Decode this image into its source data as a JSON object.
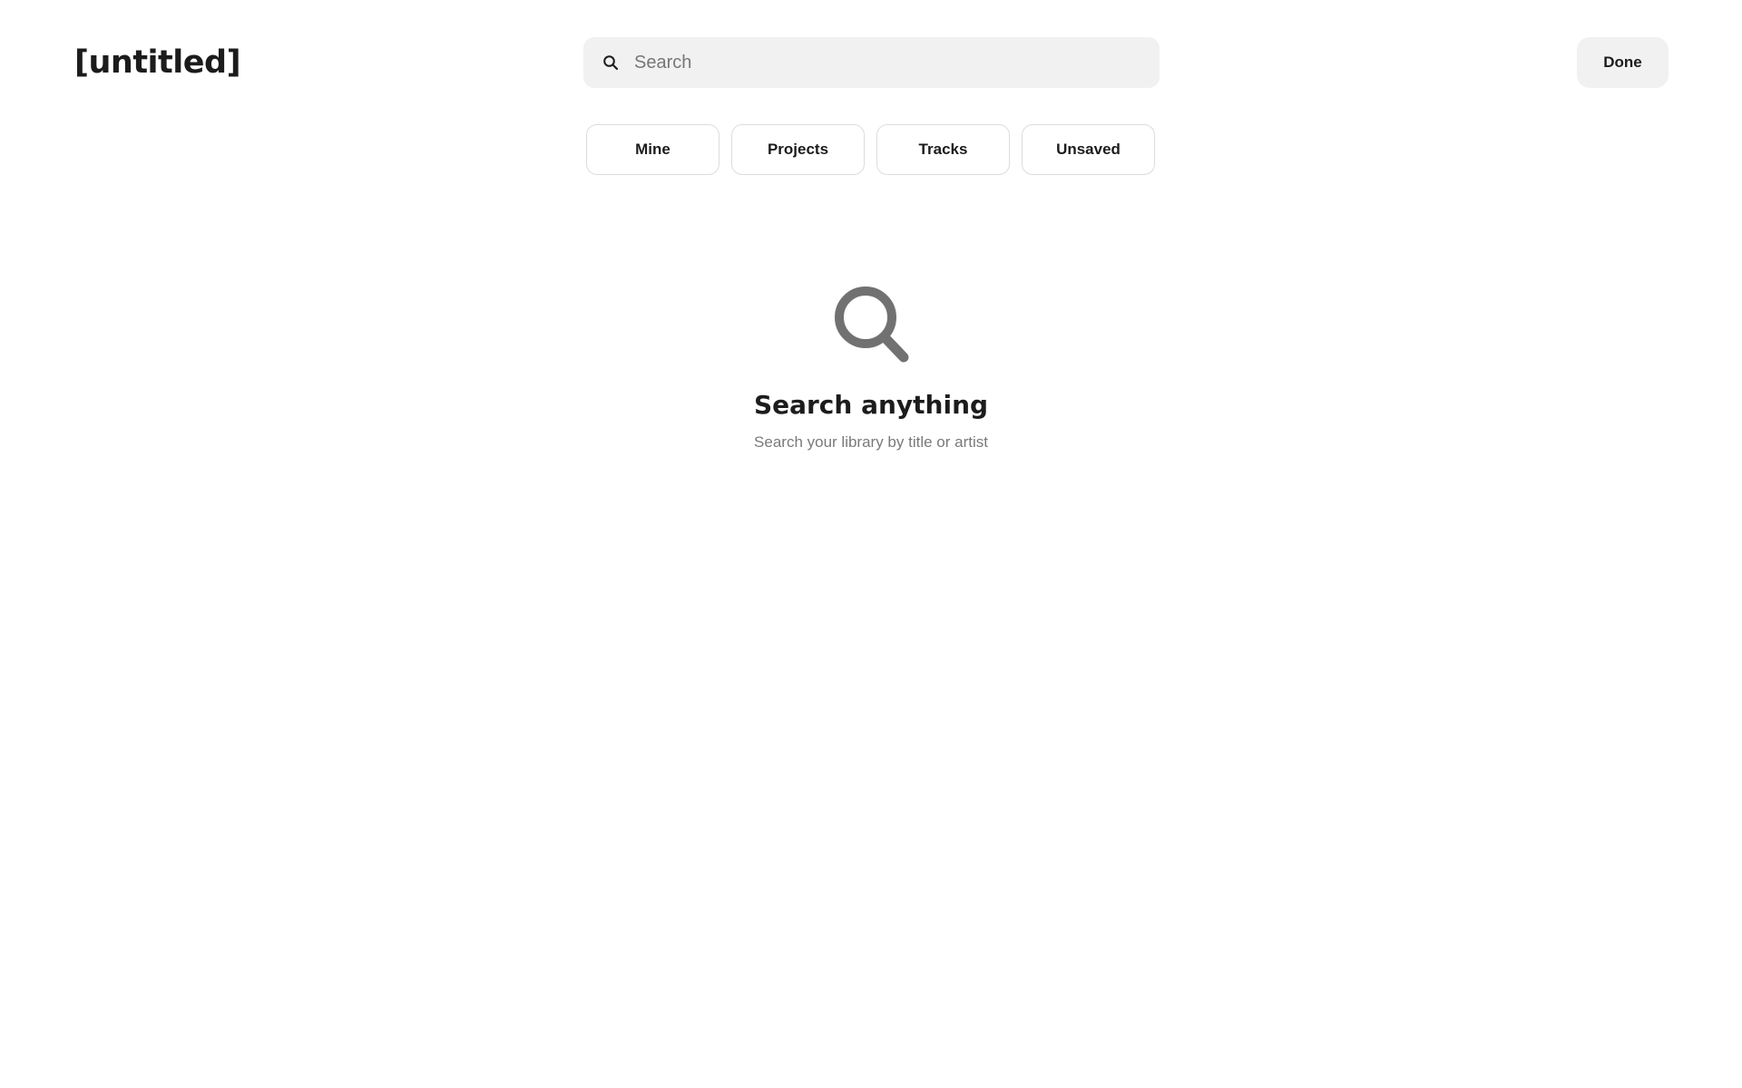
{
  "header": {
    "title": "[untitled]",
    "done_label": "Done"
  },
  "search": {
    "placeholder": "Search",
    "value": "",
    "icon": "search-icon"
  },
  "filters": [
    {
      "label": "Mine"
    },
    {
      "label": "Projects"
    },
    {
      "label": "Tracks"
    },
    {
      "label": "Unsaved"
    }
  ],
  "empty_state": {
    "icon": "search-icon",
    "title": "Search anything",
    "subtitle": "Search your library by title or artist"
  },
  "colors": {
    "background": "#ffffff",
    "text": "#1c1c1c",
    "muted_text": "#7a7a7a",
    "field_background": "#f1f1f1",
    "chip_border": "#dcdcdc",
    "icon_gray": "#717171"
  }
}
